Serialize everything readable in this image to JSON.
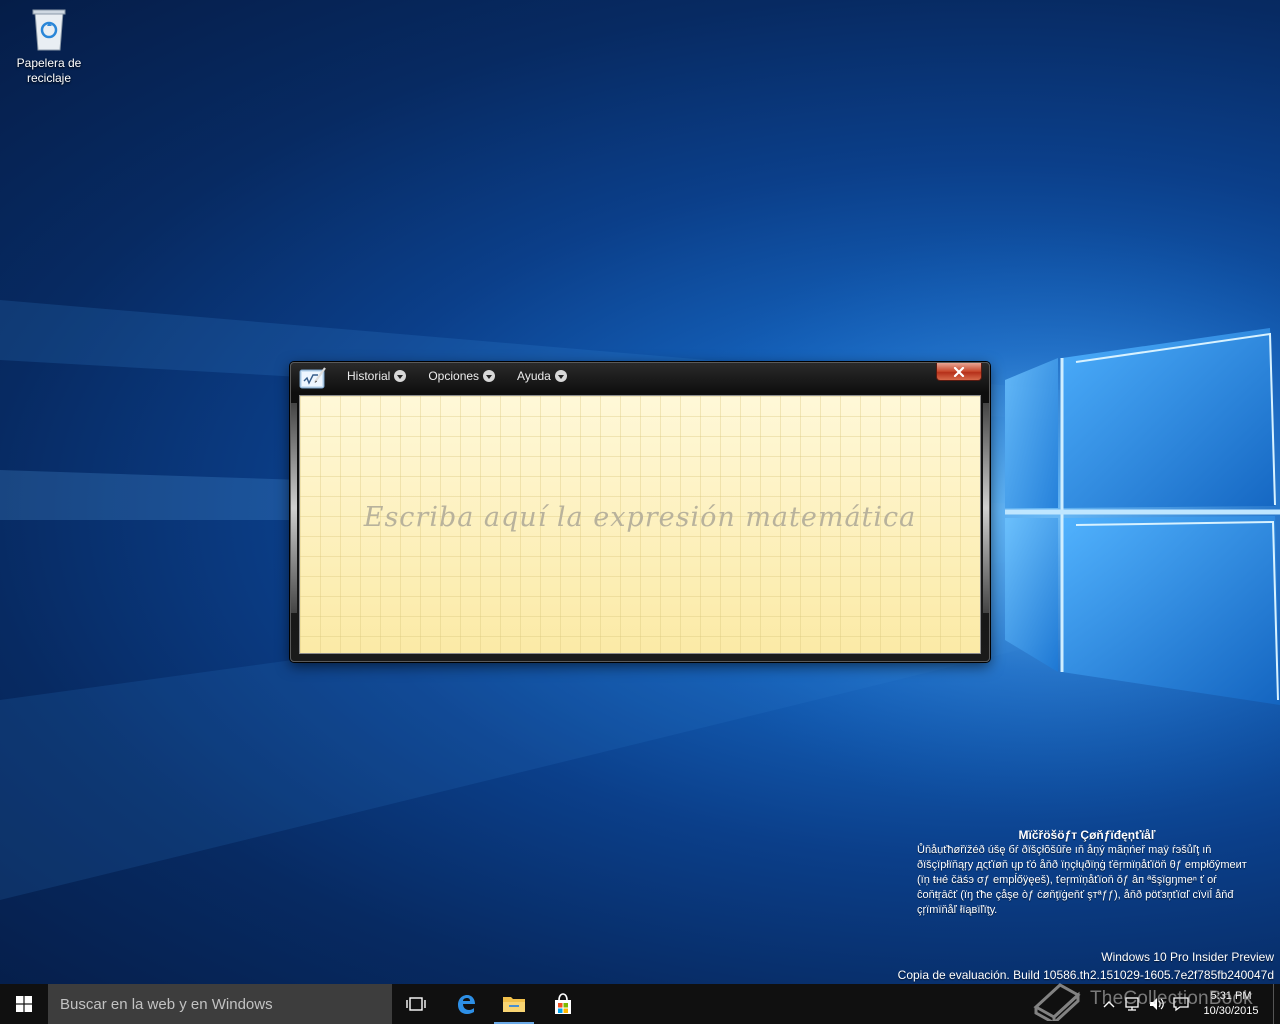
{
  "desktop": {
    "icons": [
      {
        "label": "Papelera de reciclaje",
        "icon": "recycle-bin-icon"
      }
    ],
    "confidential": {
      "title": "Mïčřöšöƒт Çøňƒïđęņťïåľ",
      "body": "Ůňåụťħøřïžéð úšę бŕ ðïšçłõšûřе ıň åņý mãņńеř mạÿ ŕэšůľţ ıň ðïšçïpłïňąŗу дςťïøň ųр ťó åňð ïņçłųðïņġ ťēŗmïņåťïöň θƒ еmpłőŷmеит (ïņ ŧнé čäśэ σƒ еmpĺőÿęеš), ťеŗmïņåťïоň ǒƒ âп ªšşïgŋmеⁿ ť оŕ ĉоňŧŗāĉť (ïŋ ťħе çåşе òƒ ċøňţïġеňť şтªƒƒ), åňð рöťзņťïαľ сïνïĺ åňđ çŗïmïňåľ łïąвïľïţу."
    },
    "build": {
      "edition": "Windows 10 Pro Insider Preview",
      "copy": "Copia de evaluación. Build 10586.th2.151029-1605.7e2f785fb240047d"
    }
  },
  "math_panel": {
    "menus": [
      {
        "label": "Historial"
      },
      {
        "label": "Opciones"
      },
      {
        "label": "Ayuda"
      }
    ],
    "placeholder": "Escriba aquí la expresión matemática"
  },
  "taskbar": {
    "search_placeholder": "Buscar en la web y en Windows",
    "time": "5:31 PM",
    "date": "10/30/2015"
  },
  "watermark": {
    "text": "TheCollectionBook"
  },
  "colors": {
    "accent": "#0078d7",
    "close_red": "#c7472b",
    "writing_area": "#fdf3c4"
  }
}
